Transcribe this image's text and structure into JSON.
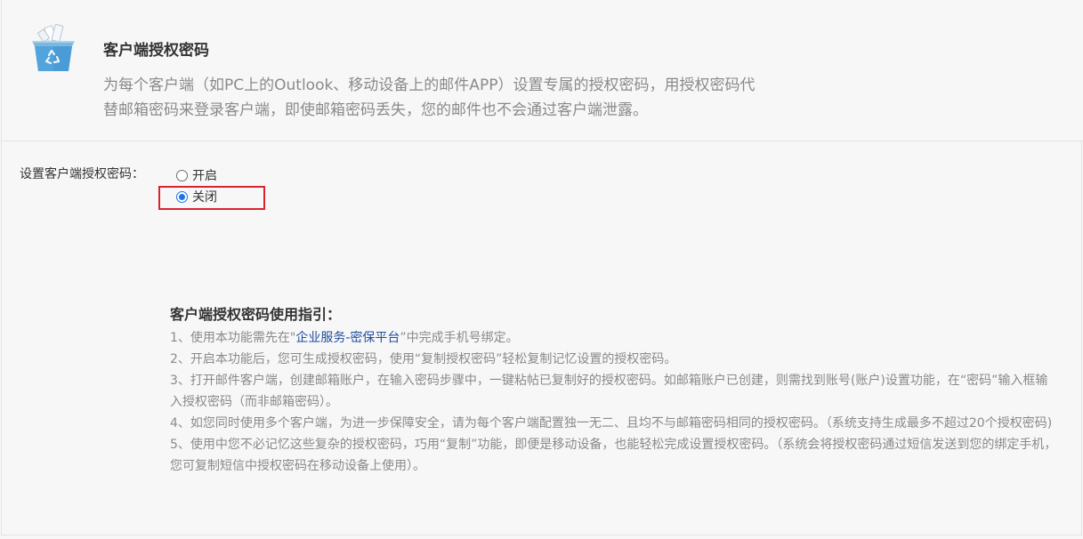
{
  "header": {
    "icon": "recycle-box-icon",
    "title": "客户端授权密码",
    "description": "为每个客户端（如PC上的Outlook、移动设备上的邮件APP）设置专属的授权密码，用授权密码代替邮箱密码来登录客户端，即使邮箱密码丢失，您的邮件也不会通过客户端泄露。"
  },
  "setting": {
    "label": "设置客户端授权密码：",
    "options": [
      {
        "label": "开启",
        "checked": false
      },
      {
        "label": "关闭",
        "checked": true
      }
    ],
    "accent_color": "#1874e8",
    "highlight_color": "#d9232d"
  },
  "guide": {
    "title": "客户端授权密码使用指引：",
    "item1_prefix": "1、使用本功能需先在\"",
    "item1_link": "企业服务-密保平台",
    "item1_suffix": "”中完成手机号绑定。",
    "item2": "2、开启本功能后，您可生成授权密码，使用“复制授权密码”轻松复制记忆设置的授权密码。",
    "item3": "3、打开邮件客户端，创建邮箱账户，在输入密码步骤中，一键粘帖已复制好的授权密码。如邮箱账户已创建，则需找到账号(账户)设置功能，在“密码”输入框输入授权密码（而非邮箱密码）。",
    "item4": "4、如您同时使用多个客户端，为进一步保障安全，请为每个客户端配置独一无二、且均不与邮箱密码相同的授权密码。（系统支持生成最多不超过20个授权密码)",
    "item5": "5、使用中您不必记忆这些复杂的授权密码，巧用“复制”功能，即便是移动设备，也能轻松完成设置授权密码。（系统会将授权密码通过短信发送到您的绑定手机，您可复制短信中授权密码在移动设备上使用）。"
  }
}
